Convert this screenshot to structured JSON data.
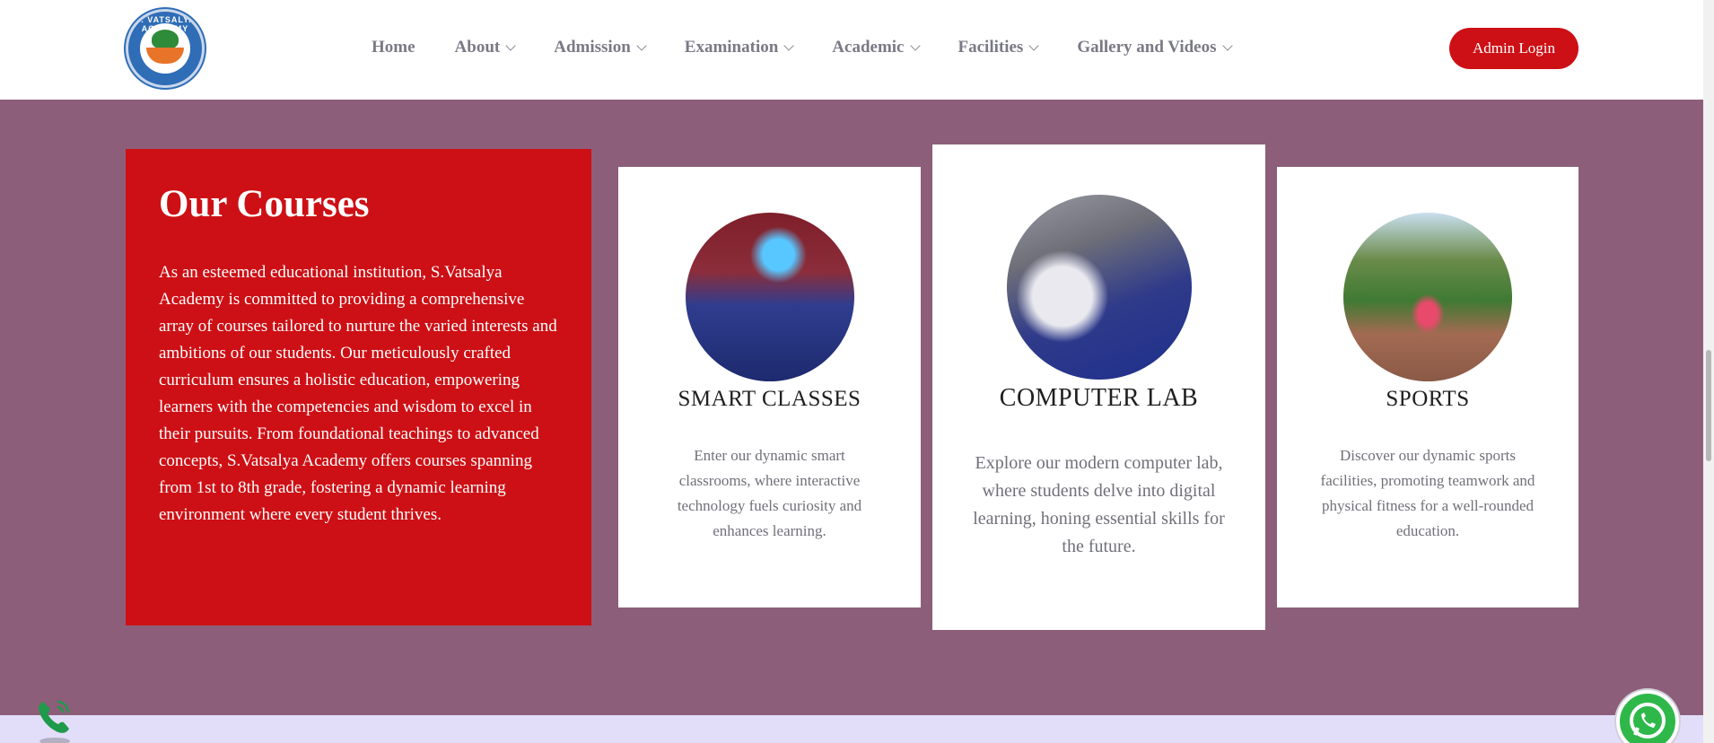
{
  "header": {
    "logo_text": "S. VATSALYA ACADEMY",
    "nav": [
      {
        "label": "Home",
        "has_dropdown": false
      },
      {
        "label": "About",
        "has_dropdown": true
      },
      {
        "label": "Admission",
        "has_dropdown": true
      },
      {
        "label": "Examination",
        "has_dropdown": true
      },
      {
        "label": "Academic",
        "has_dropdown": true
      },
      {
        "label": "Facilities",
        "has_dropdown": true
      },
      {
        "label": "Gallery and Videos",
        "has_dropdown": true
      }
    ],
    "admin_login_label": "Admin Login"
  },
  "courses": {
    "title": "Our Courses",
    "description": "As an esteemed educational institution, S.Vatsalya Academy is committed to providing a comprehensive array of courses tailored to nurture the varied interests and ambitions of our students. Our meticulously crafted curriculum ensures a holistic education, empowering learners with the competencies and wisdom to excel in their pursuits. From foundational teachings to advanced concepts, S.Vatsalya Academy offers courses spanning from 1st to 8th grade, fostering a dynamic learning environment where every student thrives."
  },
  "cards": [
    {
      "title": "SMART CLASSES",
      "description": "Enter our dynamic smart classrooms, where interactive technology fuels curiosity and enhances learning."
    },
    {
      "title": "COMPUTER LAB",
      "description": "Explore our modern computer lab, where students delve into digital learning, honing essential skills for the future."
    },
    {
      "title": "SPORTS",
      "description": "Discover our dynamic sports facilities, promoting teamwork and physical fitness for a well-rounded education."
    }
  ],
  "icons": {
    "phone": "phone-call-icon",
    "whatsapp": "whatsapp-icon",
    "dropdown": "chevron-down-icon"
  },
  "colors": {
    "accent_red": "#cd1015",
    "section_bg": "#8d5e7a",
    "bottom_band": "#e2defa",
    "whatsapp_green": "#2fb84a"
  }
}
